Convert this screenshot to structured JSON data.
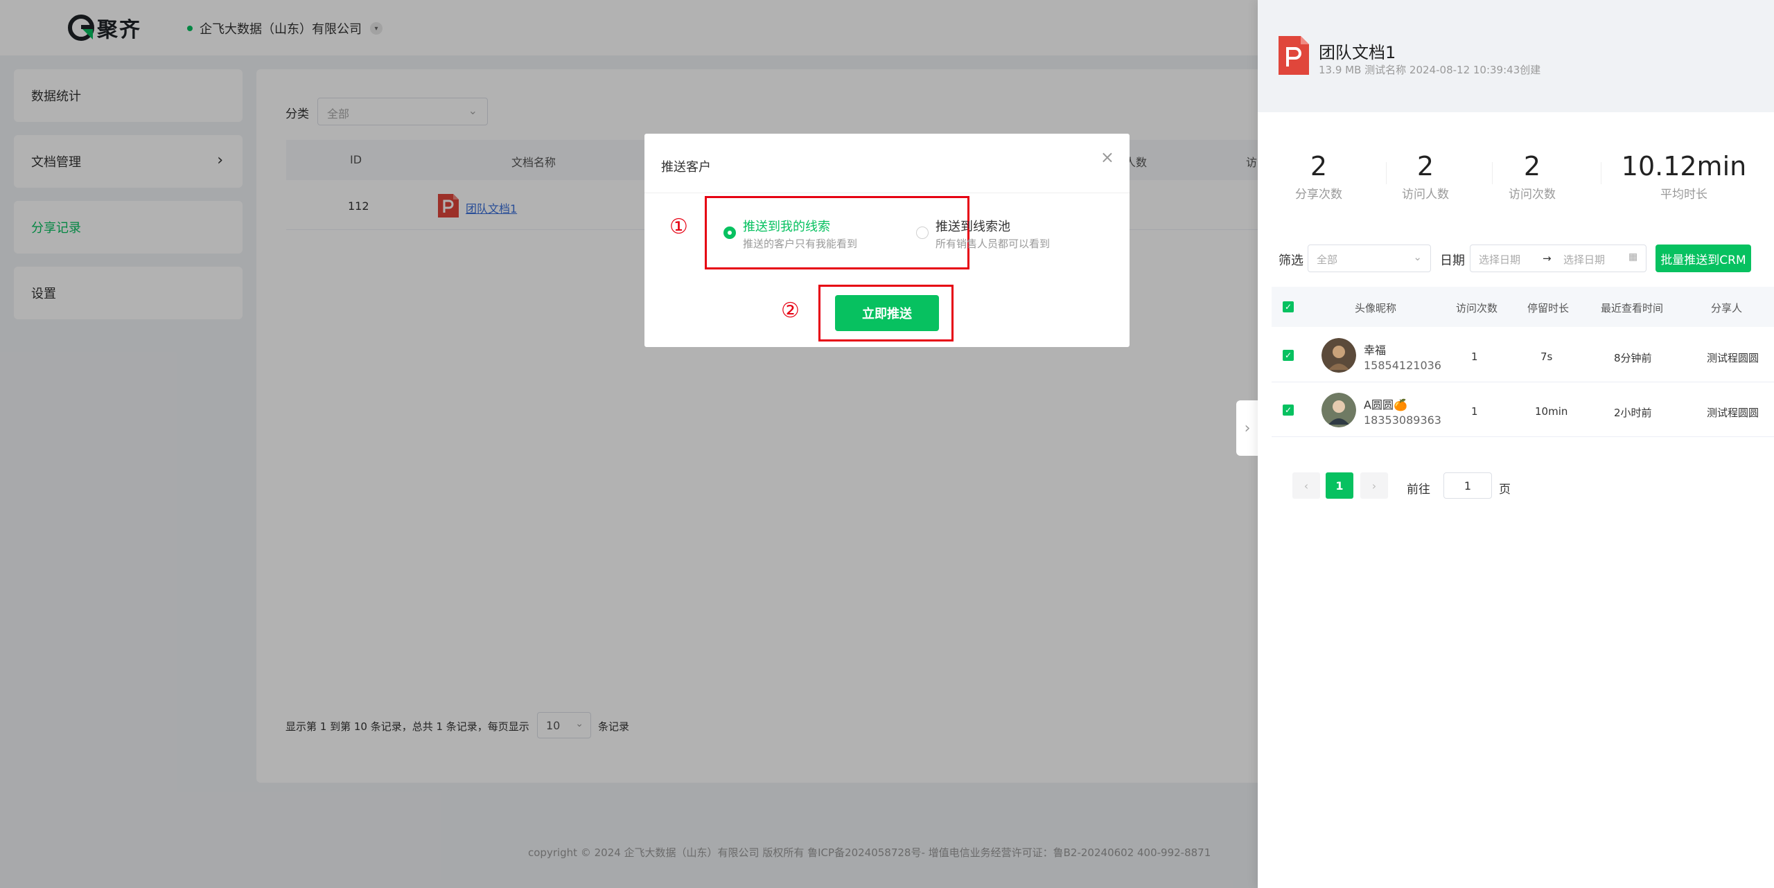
{
  "header": {
    "logo_text": "聚齐",
    "company": "企飞大数据（山东）有限公司"
  },
  "sidebar": {
    "items": [
      {
        "label": "数据统计"
      },
      {
        "label": "文档管理"
      },
      {
        "label": "分享记录"
      },
      {
        "label": "设置"
      }
    ]
  },
  "main": {
    "filter_label": "分类",
    "filter_value": "全部",
    "columns": [
      "ID",
      "文档名称",
      "人数",
      "访"
    ],
    "rows": [
      {
        "id": "112",
        "name": "团队文档1"
      }
    ],
    "pager_text": "显示第 1 到第 10 条记录，总共 1 条记录，每页显示",
    "page_size": "10",
    "records_suffix": "条记录",
    "footer": "copyright © 2024 企飞大数据（山东）有限公司 版权所有  鲁ICP备2024058728号-   增值电信业务经营许可证：鲁B2-20240602  400-992-8871"
  },
  "modal": {
    "title": "推送客户",
    "option1_title": "推送到我的线索",
    "option1_sub": "推送的客户只有我能看到",
    "option2_title": "推送到线索池",
    "option2_sub": "所有销售人员都可以看到",
    "button": "立即推送",
    "marker1": "①",
    "marker2": "②",
    "selected_option": 1
  },
  "panel": {
    "file_name": "团队文档1",
    "file_meta": "13.9 MB    测试名称    2024-08-12 10:39:43创建",
    "stats": [
      {
        "num": "2",
        "label": "分享次数"
      },
      {
        "num": "2",
        "label": "访问人数"
      },
      {
        "num": "2",
        "label": "访问次数"
      },
      {
        "num": "10.12min",
        "label": "平均时长"
      }
    ],
    "filter_label": "筛选",
    "filter_value": "全部",
    "date_label": "日期",
    "date_start": "选择日期",
    "date_sep": "→",
    "date_end": "选择日期",
    "crm_button": "批量推送到CRM",
    "columns": [
      "头像昵称",
      "访问次数",
      "停留时长",
      "最近查看时间",
      "分享人"
    ],
    "rows": [
      {
        "name": "幸福",
        "phone": "15854121036",
        "visits": "1",
        "stay": "7s",
        "last": "8分钟前",
        "sharer": "测试程圆圆"
      },
      {
        "name": "A圆圆🍊",
        "phone": "18353089363",
        "visits": "1",
        "stay": "10min",
        "last": "2小时前",
        "sharer": "测试程圆圆"
      }
    ],
    "current_page": "1",
    "goto_label": "前往",
    "goto_value": "1",
    "page_label": "页"
  },
  "colors": {
    "accent": "#07c160",
    "highlight": "#e60012",
    "ppt": "#e0463b"
  }
}
